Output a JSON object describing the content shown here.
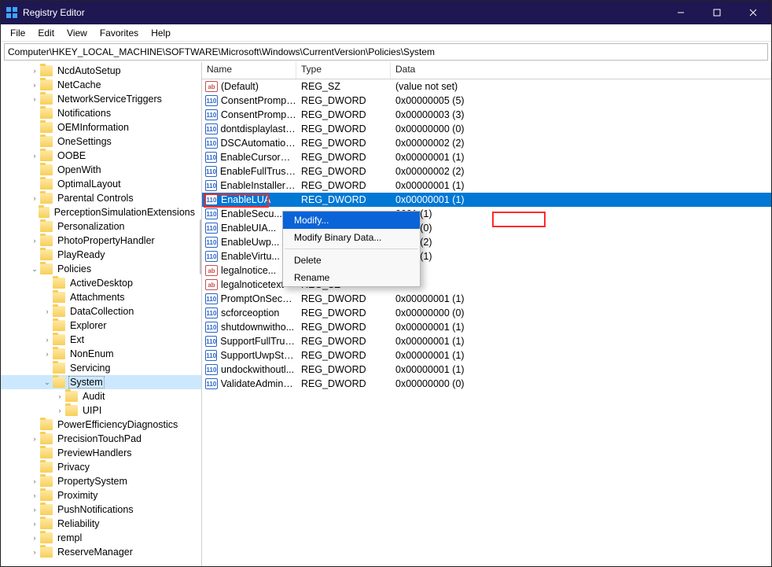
{
  "window": {
    "title": "Registry Editor"
  },
  "menu": {
    "items": [
      "File",
      "Edit",
      "View",
      "Favorites",
      "Help"
    ]
  },
  "address": {
    "path": "Computer\\HKEY_LOCAL_MACHINE\\SOFTWARE\\Microsoft\\Windows\\CurrentVersion\\Policies\\System"
  },
  "tree": {
    "items": [
      {
        "l": 2,
        "exp": ">",
        "label": "NcdAutoSetup"
      },
      {
        "l": 2,
        "exp": ">",
        "label": "NetCache"
      },
      {
        "l": 2,
        "exp": ">",
        "label": "NetworkServiceTriggers"
      },
      {
        "l": 2,
        "exp": "",
        "label": "Notifications"
      },
      {
        "l": 2,
        "exp": "",
        "label": "OEMInformation"
      },
      {
        "l": 2,
        "exp": "",
        "label": "OneSettings"
      },
      {
        "l": 2,
        "exp": ">",
        "label": "OOBE"
      },
      {
        "l": 2,
        "exp": "",
        "label": "OpenWith"
      },
      {
        "l": 2,
        "exp": "",
        "label": "OptimalLayout"
      },
      {
        "l": 2,
        "exp": ">",
        "label": "Parental Controls"
      },
      {
        "l": 2,
        "exp": "",
        "label": "PerceptionSimulationExtensions"
      },
      {
        "l": 2,
        "exp": "",
        "label": "Personalization"
      },
      {
        "l": 2,
        "exp": ">",
        "label": "PhotoPropertyHandler"
      },
      {
        "l": 2,
        "exp": "",
        "label": "PlayReady"
      },
      {
        "l": 2,
        "exp": "v",
        "label": "Policies"
      },
      {
        "l": 3,
        "exp": "",
        "label": "ActiveDesktop"
      },
      {
        "l": 3,
        "exp": "",
        "label": "Attachments"
      },
      {
        "l": 3,
        "exp": ">",
        "label": "DataCollection"
      },
      {
        "l": 3,
        "exp": "",
        "label": "Explorer"
      },
      {
        "l": 3,
        "exp": ">",
        "label": "Ext"
      },
      {
        "l": 3,
        "exp": ">",
        "label": "NonEnum"
      },
      {
        "l": 3,
        "exp": "",
        "label": "Servicing"
      },
      {
        "l": 3,
        "exp": "v",
        "label": "System",
        "selected": true
      },
      {
        "l": 4,
        "exp": ">",
        "label": "Audit"
      },
      {
        "l": 4,
        "exp": ">",
        "label": "UIPI"
      },
      {
        "l": 2,
        "exp": "",
        "label": "PowerEfficiencyDiagnostics"
      },
      {
        "l": 2,
        "exp": ">",
        "label": "PrecisionTouchPad"
      },
      {
        "l": 2,
        "exp": "",
        "label": "PreviewHandlers"
      },
      {
        "l": 2,
        "exp": "",
        "label": "Privacy"
      },
      {
        "l": 2,
        "exp": ">",
        "label": "PropertySystem"
      },
      {
        "l": 2,
        "exp": ">",
        "label": "Proximity"
      },
      {
        "l": 2,
        "exp": ">",
        "label": "PushNotifications"
      },
      {
        "l": 2,
        "exp": ">",
        "label": "Reliability"
      },
      {
        "l": 2,
        "exp": ">",
        "label": "rempl"
      },
      {
        "l": 2,
        "exp": ">",
        "label": "ReserveManager"
      }
    ]
  },
  "list": {
    "columns": {
      "name": "Name",
      "type": "Type",
      "data": "Data"
    },
    "rows": [
      {
        "icon": "sz",
        "name": "(Default)",
        "type": "REG_SZ",
        "data": "(value not set)"
      },
      {
        "icon": "dw",
        "name": "ConsentPrompt...",
        "type": "REG_DWORD",
        "data": "0x00000005 (5)"
      },
      {
        "icon": "dw",
        "name": "ConsentPrompt...",
        "type": "REG_DWORD",
        "data": "0x00000003 (3)"
      },
      {
        "icon": "dw",
        "name": "dontdisplaylastu...",
        "type": "REG_DWORD",
        "data": "0x00000000 (0)"
      },
      {
        "icon": "dw",
        "name": "DSCAutomation...",
        "type": "REG_DWORD",
        "data": "0x00000002 (2)"
      },
      {
        "icon": "dw",
        "name": "EnableCursorSu...",
        "type": "REG_DWORD",
        "data": "0x00000001 (1)"
      },
      {
        "icon": "dw",
        "name": "EnableFullTrustS...",
        "type": "REG_DWORD",
        "data": "0x00000002 (2)"
      },
      {
        "icon": "dw",
        "name": "EnableInstallerD...",
        "type": "REG_DWORD",
        "data": "0x00000001 (1)"
      },
      {
        "icon": "dw",
        "name": "EnableLUA",
        "type": "REG_DWORD",
        "data": "0x00000001 (1)",
        "selected": true,
        "highlight": true
      },
      {
        "icon": "dw",
        "name": "EnableSecu...",
        "type": "",
        "data": "0001 (1)"
      },
      {
        "icon": "dw",
        "name": "EnableUIA...",
        "type": "",
        "data": "0000 (0)"
      },
      {
        "icon": "dw",
        "name": "EnableUwp...",
        "type": "",
        "data": "0002 (2)"
      },
      {
        "icon": "dw",
        "name": "EnableVirtu...",
        "type": "",
        "data": "0001 (1)"
      },
      {
        "icon": "sz",
        "name": "legalnotice...",
        "type": "",
        "data": ""
      },
      {
        "icon": "sz",
        "name": "legalnoticetext",
        "type": "REG_SZ",
        "data": ""
      },
      {
        "icon": "dw",
        "name": "PromptOnSecur...",
        "type": "REG_DWORD",
        "data": "0x00000001 (1)"
      },
      {
        "icon": "dw",
        "name": "scforceoption",
        "type": "REG_DWORD",
        "data": "0x00000000 (0)"
      },
      {
        "icon": "dw",
        "name": "shutdownwitho...",
        "type": "REG_DWORD",
        "data": "0x00000001 (1)"
      },
      {
        "icon": "dw",
        "name": "SupportFullTrust...",
        "type": "REG_DWORD",
        "data": "0x00000001 (1)"
      },
      {
        "icon": "dw",
        "name": "SupportUwpStar...",
        "type": "REG_DWORD",
        "data": "0x00000001 (1)"
      },
      {
        "icon": "dw",
        "name": "undockwithoutl...",
        "type": "REG_DWORD",
        "data": "0x00000001 (1)"
      },
      {
        "icon": "dw",
        "name": "ValidateAdminC...",
        "type": "REG_DWORD",
        "data": "0x00000000 (0)"
      }
    ]
  },
  "context_menu": {
    "modify": "Modify...",
    "modify_binary": "Modify Binary Data...",
    "delete": "Delete",
    "rename": "Rename"
  },
  "icons": {
    "sz_label": "ab",
    "dw_label": "110"
  }
}
